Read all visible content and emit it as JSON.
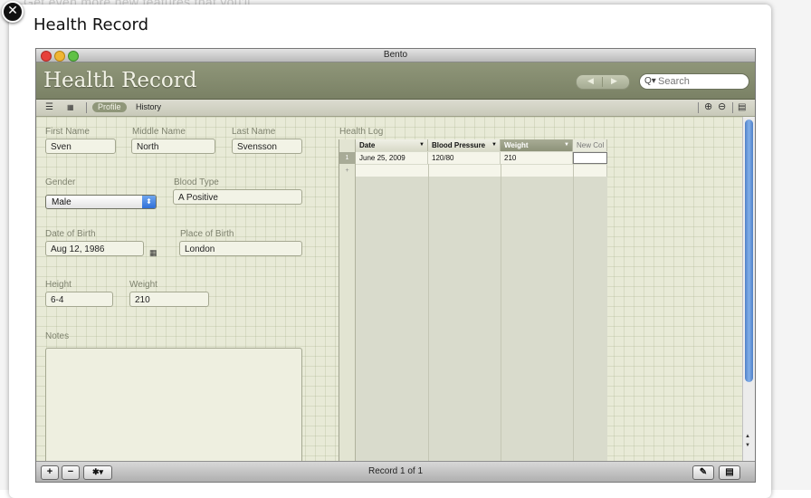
{
  "background_text": "Get even more new features that you'll",
  "lightbox": {
    "title": "Health Record"
  },
  "window": {
    "title": "Bento"
  },
  "banner": {
    "title": "Health Record",
    "nav_prev": "◀",
    "nav_next": "▶"
  },
  "search": {
    "placeholder": "Search"
  },
  "toolbar": {
    "tab_profile": "Profile",
    "tab_history": "History"
  },
  "form": {
    "first_name": {
      "label": "First Name",
      "value": "Sven"
    },
    "middle_name": {
      "label": "Middle Name",
      "value": "North"
    },
    "last_name": {
      "label": "Last Name",
      "value": "Svensson"
    },
    "gender": {
      "label": "Gender",
      "value": "Male"
    },
    "blood_type": {
      "label": "Blood Type",
      "value": "A Positive"
    },
    "date_of_birth": {
      "label": "Date of Birth",
      "value": "Aug 12, 1986"
    },
    "place_of_birth": {
      "label": "Place of Birth",
      "value": "London"
    },
    "height": {
      "label": "Height",
      "value": "6-4"
    },
    "weight": {
      "label": "Weight",
      "value": "210"
    },
    "notes": {
      "label": "Notes",
      "value": ""
    }
  },
  "health_log": {
    "title": "Health Log",
    "columns": [
      "Date",
      "Blood Pressure",
      "Weight",
      "New Col"
    ],
    "rows": [
      {
        "num": "1",
        "date": "June 25, 2009",
        "bp": "120/80",
        "weight": "210"
      }
    ],
    "add_row_marker": "+"
  },
  "status": {
    "record_label": "Record 1 of 1"
  },
  "colors": {
    "banner": "#8f9679",
    "field_bg": "#f2f3e6",
    "selected_column": "#8d9279",
    "scroll_thumb": "#4f80c8"
  }
}
